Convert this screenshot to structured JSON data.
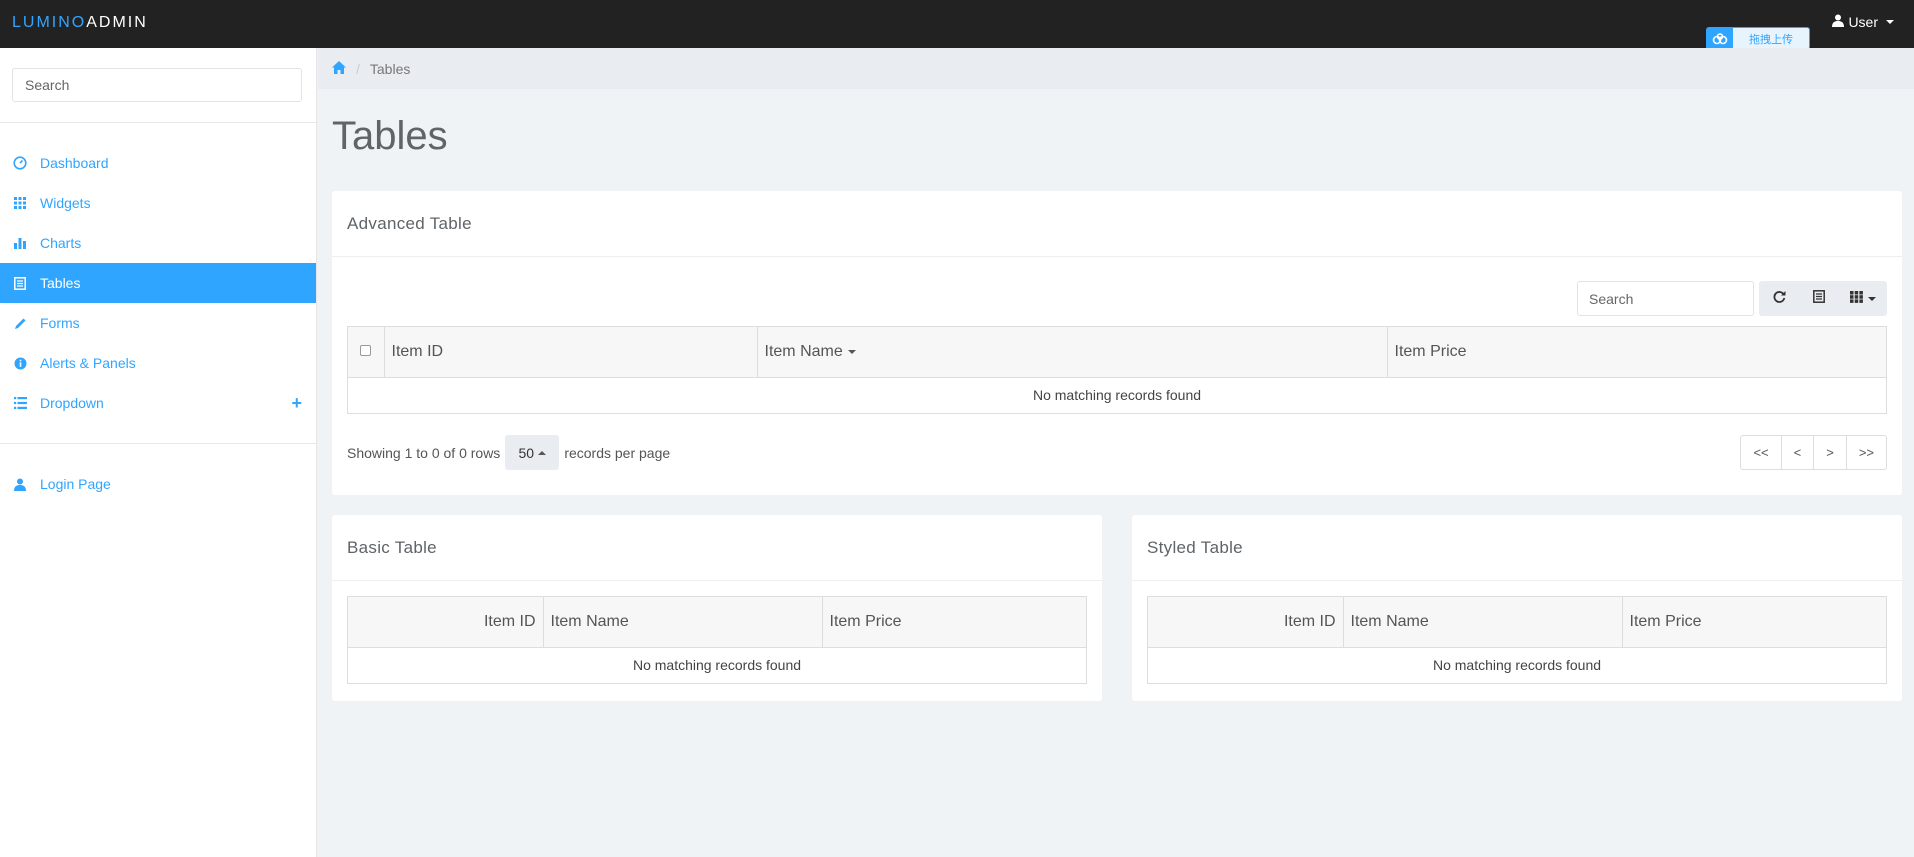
{
  "brand": {
    "part1": "LUMINO",
    "part2": "ADMIN"
  },
  "user_menu": {
    "label": "User"
  },
  "upload_widget": {
    "label": "拖拽上传"
  },
  "sidebar": {
    "search_placeholder": "Search",
    "items": [
      {
        "label": "Dashboard",
        "icon": "dashboard-icon",
        "active": false
      },
      {
        "label": "Widgets",
        "icon": "grid-icon",
        "active": false
      },
      {
        "label": "Charts",
        "icon": "bar-chart-icon",
        "active": false
      },
      {
        "label": "Tables",
        "icon": "table-icon",
        "active": true
      },
      {
        "label": "Forms",
        "icon": "pencil-icon",
        "active": false
      },
      {
        "label": "Alerts & Panels",
        "icon": "info-icon",
        "active": false
      },
      {
        "label": "Dropdown",
        "icon": "list-icon",
        "active": false
      }
    ],
    "login_item": {
      "label": "Login Page",
      "icon": "user-icon"
    }
  },
  "breadcrumb": {
    "current": "Tables"
  },
  "page_title": "Tables",
  "colors": {
    "accent": "#30a5ff",
    "navbar": "#222222",
    "background": "#f0f3f6"
  },
  "advanced_table": {
    "title": "Advanced Table",
    "search_placeholder": "Search",
    "columns": [
      "Item ID",
      "Item Name",
      "Item Price"
    ],
    "empty_text": "No matching records found",
    "showing_text": "Showing 1 to 0 of 0 rows",
    "per_page_value": "50",
    "per_page_suffix": "records per page",
    "pager": [
      "<<",
      "<",
      ">",
      ">>"
    ]
  },
  "basic_table": {
    "title": "Basic Table",
    "columns": [
      "Item ID",
      "Item Name",
      "Item Price"
    ],
    "empty_text": "No matching records found"
  },
  "styled_table": {
    "title": "Styled Table",
    "columns": [
      "Item ID",
      "Item Name",
      "Item Price"
    ],
    "empty_text": "No matching records found"
  }
}
